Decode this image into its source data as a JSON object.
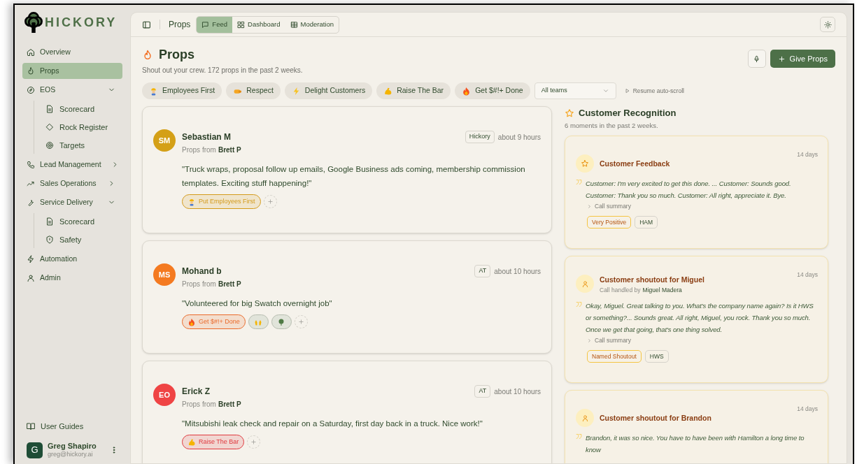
{
  "brand": {
    "name": "HICKORY"
  },
  "sidebar": {
    "items": [
      {
        "label": "Overview",
        "selected": false
      },
      {
        "label": "Props",
        "selected": true
      },
      {
        "label": "EOS",
        "selected": false,
        "expanded": true,
        "children": [
          {
            "label": "Scorecard",
            "selected": false
          },
          {
            "label": "Rock Register",
            "selected": false
          },
          {
            "label": "Targets",
            "selected": false
          }
        ]
      },
      {
        "label": "Lead Management",
        "selected": false,
        "expanded": false
      },
      {
        "label": "Sales Operations",
        "selected": false,
        "expanded": false
      },
      {
        "label": "Service Delivery",
        "selected": false,
        "expanded": true,
        "children": [
          {
            "label": "Scorecard",
            "selected": false
          },
          {
            "label": "Safety",
            "selected": false
          }
        ]
      },
      {
        "label": "Automation",
        "selected": false
      },
      {
        "label": "Admin",
        "selected": false
      }
    ],
    "footer_link": "User Guides",
    "user": {
      "initial": "G",
      "name": "Greg Shapiro",
      "email": "greg@hickory.ai"
    }
  },
  "topbar": {
    "title": "Props",
    "views": [
      {
        "label": "Feed",
        "selected": true
      },
      {
        "label": "Dashboard",
        "selected": false
      },
      {
        "label": "Moderation",
        "selected": false
      }
    ]
  },
  "header": {
    "title": "Props",
    "subtitle": "Shout out your crew. 172 props in the past 2 weeks.",
    "give_button": "Give Props"
  },
  "filters": {
    "chips": [
      "Employees First",
      "Respect",
      "Delight Customers",
      "Raise The Bar",
      "Get $#!+ Done"
    ],
    "team_select": "All teams",
    "resume": "Resume auto-scroll"
  },
  "feed": [
    {
      "initials": "SM",
      "color": "#d4a017",
      "name": "Sebastian M",
      "from_prefix": "Props from",
      "from": "Brett P",
      "team": "Hickory",
      "time": "about 9 hours",
      "quote": "\"Truck wraps, proposal follow up emails, Google Business ads coming, membership commission templates. Exciting stuff happening!\"",
      "tags": [
        {
          "kind": "value",
          "label": "Put Employees First",
          "color": "#d49a1a"
        }
      ]
    },
    {
      "initials": "MS",
      "color": "#f47a20",
      "name": "Mohand b",
      "from_prefix": "Props from",
      "from": "Brett P",
      "team": "AT",
      "time": "about 10 hours",
      "quote": "\"Volunteered for big Swatch overnight job\"",
      "tags": [
        {
          "kind": "value",
          "label": "Get $#!+ Done",
          "color": "#ea6a2a"
        },
        {
          "kind": "reaction"
        },
        {
          "kind": "reaction"
        }
      ]
    },
    {
      "initials": "EO",
      "color": "#ef4444",
      "name": "Erick Z",
      "from_prefix": "Props from",
      "from": "Brett P",
      "team": "AT",
      "time": "about 10 hours",
      "quote": "\"Mitsubishi leak check and repair on a Saturday, first day back in a truck. Nice work!\"",
      "tags": [
        {
          "kind": "value",
          "label": "Raise The Bar",
          "color": "#e0393e"
        }
      ]
    }
  ],
  "recognition": {
    "title": "Customer Recognition",
    "subtitle": "6 moments in the past 2 weeks.",
    "moments": [
      {
        "kind": "feedback",
        "title": "Customer Feedback",
        "date": "14 days",
        "quote": "Customer: I'm very excited to get this done. ... Customer: Sounds good. Customer: Thank you so much. Customer: All right, appreciate it. Bye.",
        "summary": "Call summary",
        "tags": [
          {
            "kind": "sentiment",
            "label": "Very Positive"
          },
          {
            "kind": "team",
            "label": "HAM"
          }
        ]
      },
      {
        "kind": "shoutout",
        "title": "Customer shoutout for Miguel",
        "handled_prefix": "Call handled by",
        "handled_by": "Miguel Madera",
        "date": "14 days",
        "quote": "Okay, Miguel. Great talking to you. What's the company name again? Is it HWS or something?... Sounds great. All right, Miguel, you rock. Thank you so much. Once we get that going, that's one thing solved.",
        "summary": "Call summary",
        "tags": [
          {
            "kind": "sentiment",
            "label": "Named Shoutout"
          },
          {
            "kind": "team",
            "label": "HWS"
          }
        ]
      },
      {
        "kind": "shoutout",
        "title": "Customer shoutout for Brandon",
        "date": "14 days",
        "quote": "Brandon, it was so nice. You have to have been with Hamilton a long time to know"
      }
    ]
  }
}
